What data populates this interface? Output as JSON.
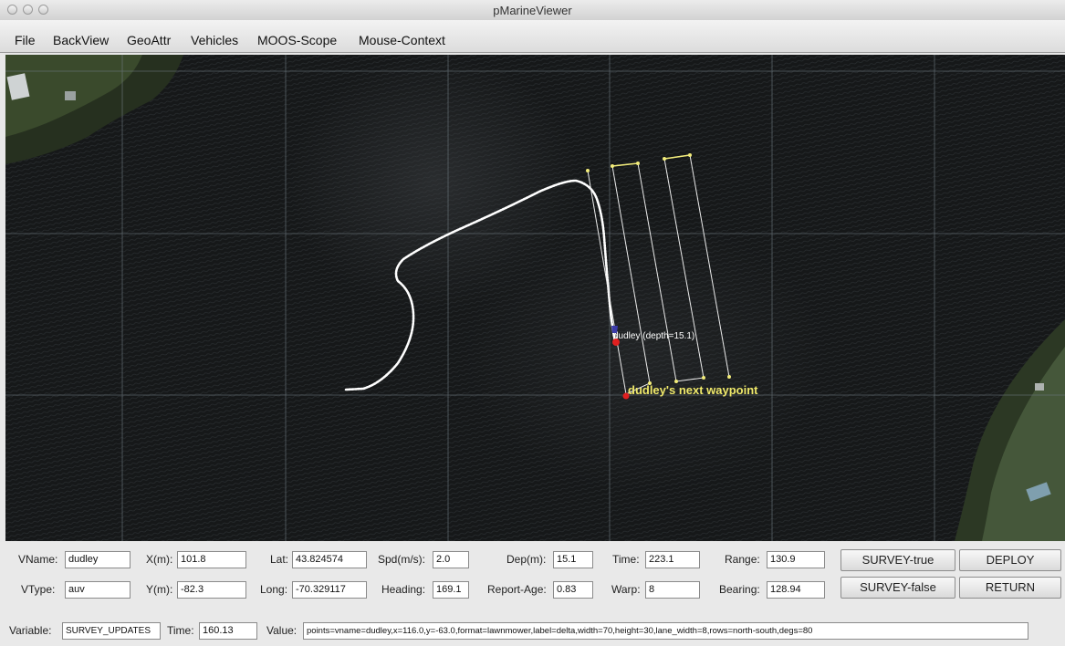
{
  "window": {
    "title": "pMarineViewer"
  },
  "menu": [
    "File",
    "BackView",
    "GeoAttr",
    "Vehicles",
    "MOOS-Scope",
    "Mouse-Context"
  ],
  "map": {
    "vehicle_label": "dudley (depth=15.1)",
    "waypoint_label": "dudley's next waypoint",
    "colors": {
      "track": "#ffffff",
      "survey": "#f2ec7a",
      "vehicle": "#e02020",
      "waypoint_label": "#efe86a"
    }
  },
  "vehicle_panel": {
    "vname_label": "VName:",
    "vname": "dudley",
    "vtype_label": "VType:",
    "vtype": "auv",
    "x_label": "X(m):",
    "x": "101.8",
    "y_label": "Y(m):",
    "y": "-82.3",
    "lat_label": "Lat:",
    "lat": "43.824574",
    "long_label": "Long:",
    "long": "-70.329117",
    "spd_label": "Spd(m/s):",
    "spd": "2.0",
    "heading_label": "Heading:",
    "heading": "169.1",
    "dep_label": "Dep(m):",
    "dep": "15.1",
    "report_age_label": "Report-Age:",
    "report_age": "0.83",
    "time_label": "Time:",
    "time": "223.1",
    "warp_label": "Warp:",
    "warp": "8",
    "range_label": "Range:",
    "range": "130.9",
    "bearing_label": "Bearing:",
    "bearing": "128.94"
  },
  "buttons": {
    "survey_true": "SURVEY-true",
    "survey_false": "SURVEY-false",
    "deploy": "DEPLOY",
    "return": "RETURN"
  },
  "scope": {
    "variable_label": "Variable:",
    "variable": "SURVEY_UPDATES",
    "time_label": "Time:",
    "time": "160.13",
    "value_label": "Value:",
    "value": "points=vname=dudley,x=116.0,y=-63.0,format=lawnmower,label=delta,width=70,height=30,lane_width=8,rows=north-south,degs=80"
  }
}
